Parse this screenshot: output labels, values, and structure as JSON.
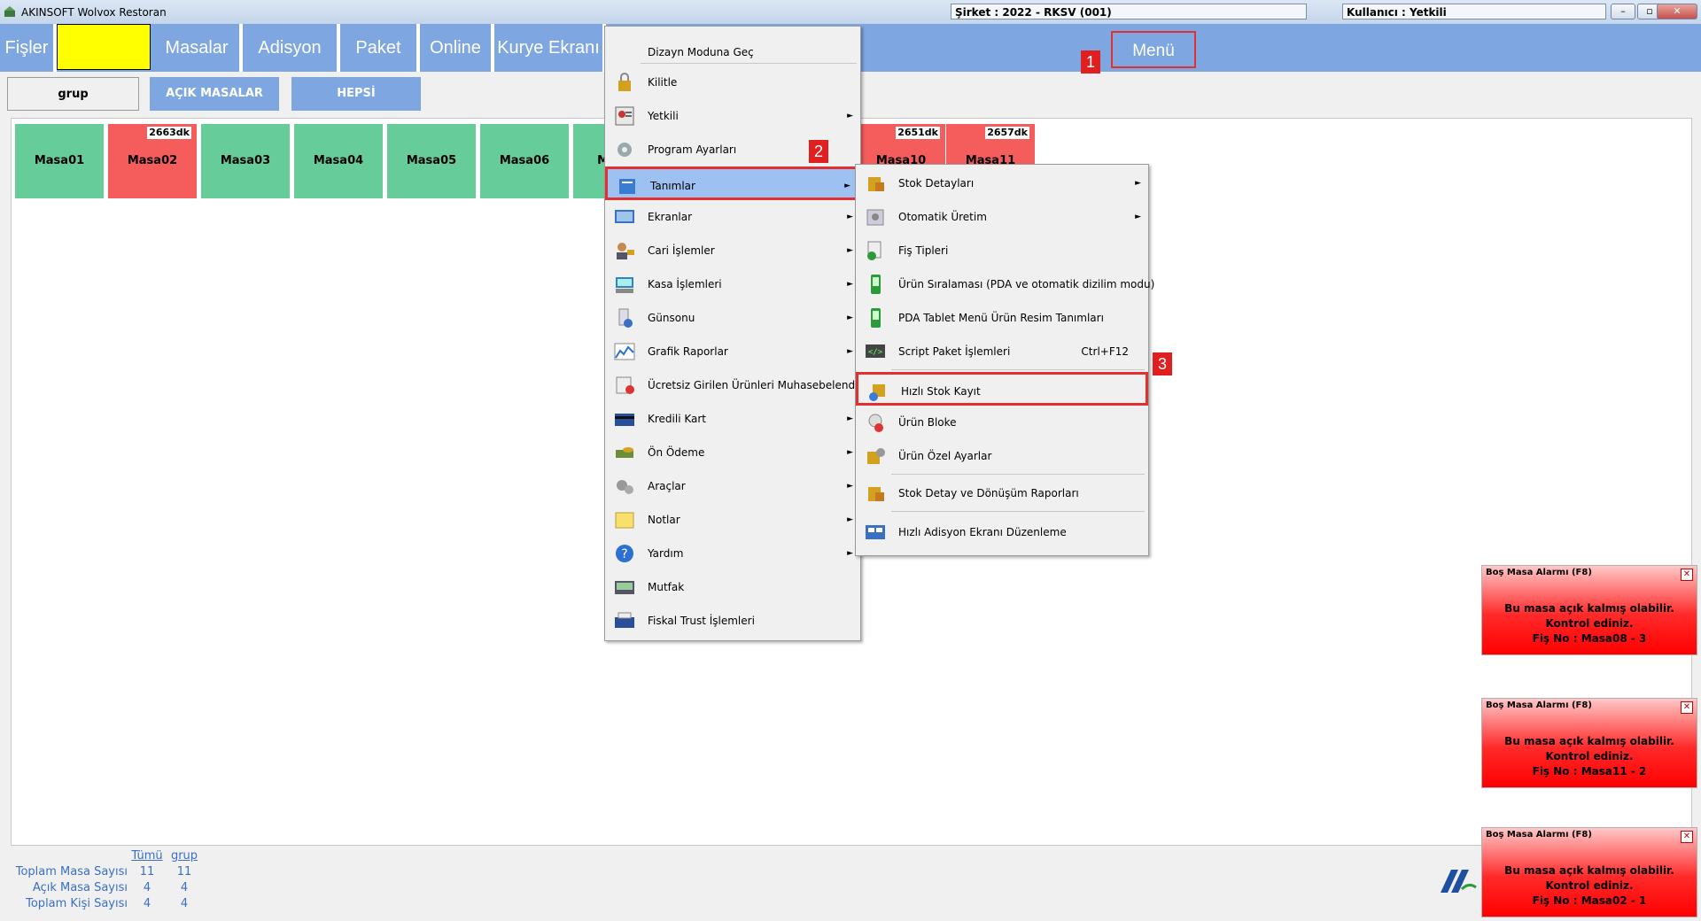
{
  "window": {
    "title": "AKINSOFT Wolvox Restoran",
    "company": "Şirket : 2022 - RKSV (001)",
    "user": "Kullanıcı : Yetkili"
  },
  "toolbar": {
    "items": [
      "Fişler",
      "",
      "Masalar",
      "Adisyon",
      "Paket",
      "Online",
      "Kurye Ekranı"
    ],
    "menu_label": "Menü"
  },
  "filters": {
    "grup": "grup",
    "acik": "AÇIK MASALAR",
    "hepsi": "HEPSİ"
  },
  "tables": [
    {
      "name": "Masa01",
      "timer": ""
    },
    {
      "name": "Masa02",
      "timer": "2663dk"
    },
    {
      "name": "Masa03",
      "timer": ""
    },
    {
      "name": "Masa04",
      "timer": ""
    },
    {
      "name": "Masa05",
      "timer": ""
    },
    {
      "name": "Masa06",
      "timer": ""
    },
    {
      "name": "M",
      "timer": ""
    },
    {
      "name": "Masa10",
      "timer": "2651dk"
    },
    {
      "name": "Masa11",
      "timer": "2657dk"
    }
  ],
  "menu": {
    "items": [
      "Dizayn Moduna Geç",
      "Kilitle",
      "Yetkili",
      "Program Ayarları",
      "Tanımlar",
      "Ekranlar",
      "Cari İşlemler",
      "Kasa İşlemleri",
      "Günsonu",
      "Grafik Raporlar",
      "Ücretsiz Girilen Ürünleri Muhasebelendir",
      "Kredili Kart",
      "Ön Ödeme",
      "Araçlar",
      "Notlar",
      "Yardım",
      "Mutfak",
      "Fiskal Trust İşlemleri"
    ]
  },
  "submenu": {
    "items": [
      "Stok Detayları",
      "Otomatik Üretim",
      "Fiş Tipleri",
      "Ürün Sıralaması (PDA ve otomatik dizilim modu)",
      "PDA Tablet Menü Ürün Resim Tanımları",
      "Script Paket İşlemleri",
      "Hızlı Stok Kayıt",
      "Ürün Bloke",
      "Ürün Özel Ayarlar",
      "Stok Detay ve Dönüşüm Raporları",
      "Hızlı Adisyon Ekranı Düzenleme"
    ],
    "shortcut": "Ctrl+F12"
  },
  "badges": [
    "1",
    "2",
    "3"
  ],
  "alarms": [
    {
      "title": "Boş Masa Alarmı (F8)",
      "message": "Bu masa açık kalmış olabilir. Kontrol ediniz.",
      "fis": "Fiş No : Masa08 - 3"
    },
    {
      "title": "Boş Masa Alarmı (F8)",
      "message": "Bu masa açık kalmış olabilir. Kontrol ediniz.",
      "fis": "Fiş No : Masa11 - 2"
    },
    {
      "title": "Boş Masa Alarmı (F8)",
      "message": "Bu masa açık kalmış olabilir. Kontrol ediniz.",
      "fis": "Fiş No : Masa02 - 1"
    }
  ],
  "stats": {
    "headers": [
      "Tümü",
      "grup"
    ],
    "rows": [
      {
        "label": "Toplam Masa Sayısı",
        "all": "11",
        "grup": "11"
      },
      {
        "label": "Açık Masa Sayısı",
        "all": "4",
        "grup": "4"
      },
      {
        "label": "Toplam Kişi Sayısı",
        "all": "4",
        "grup": "4"
      }
    ]
  },
  "colors": {
    "toolbar": "#7ea6e0",
    "table_free": "#66cc99",
    "table_busy": "#f55d5d",
    "highlight": "#e03030",
    "menu_hover": "#9dc2f2"
  }
}
